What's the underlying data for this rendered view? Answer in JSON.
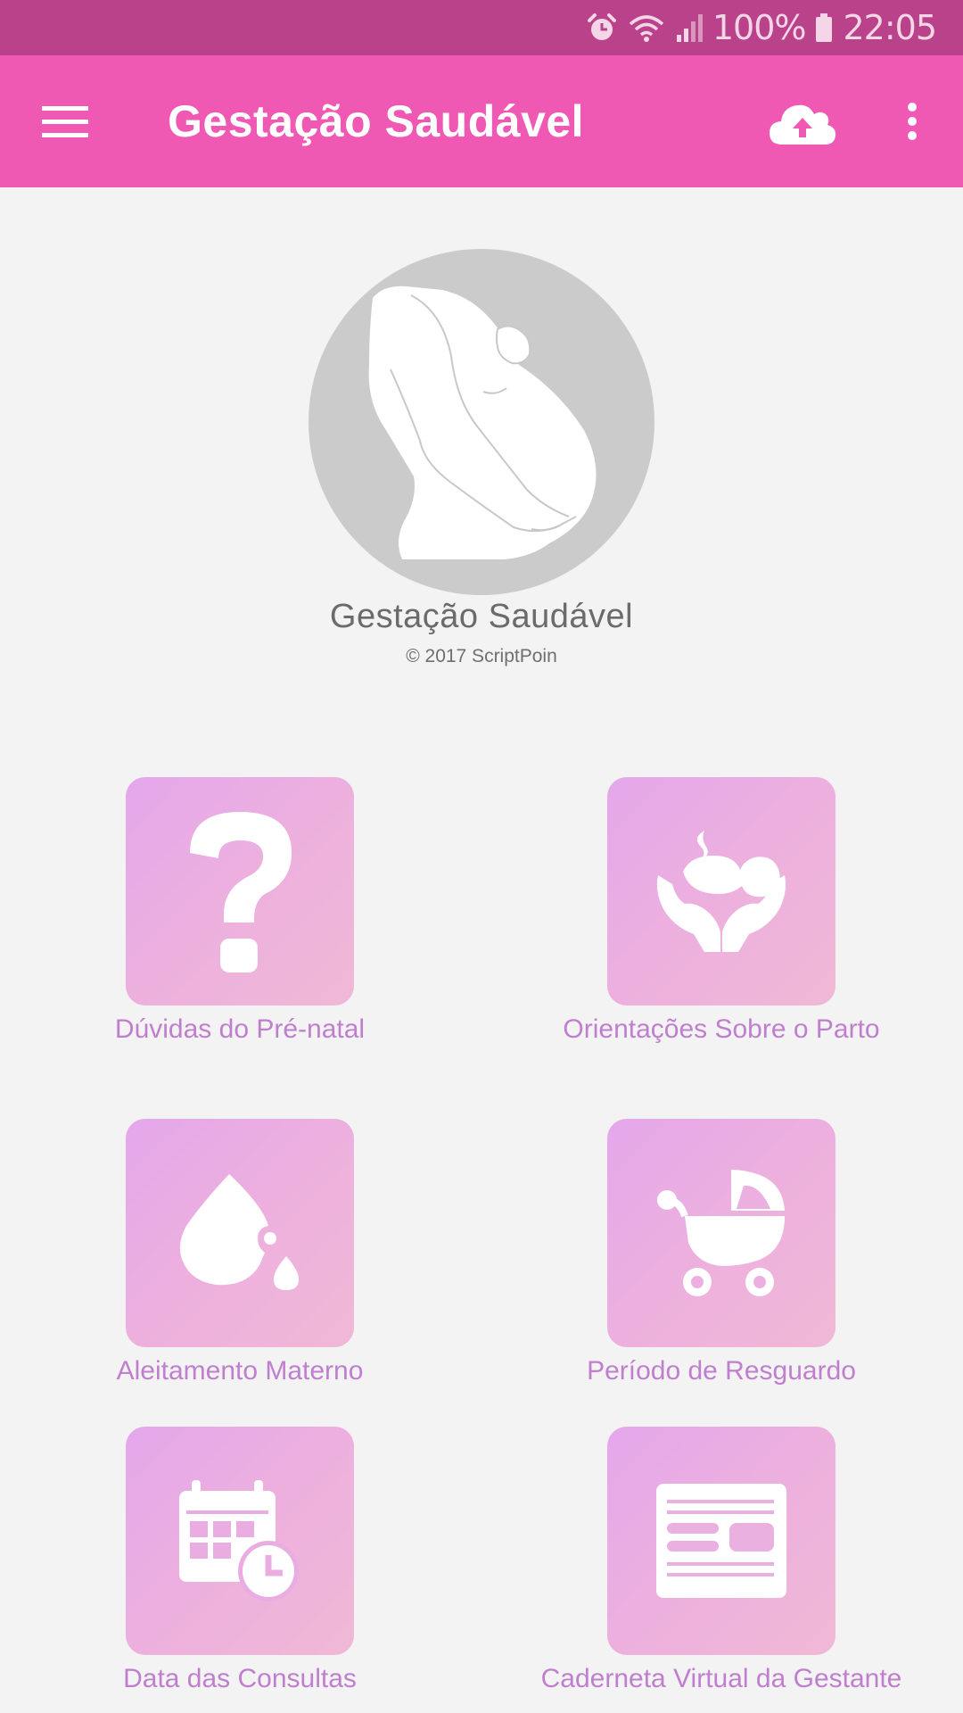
{
  "status_bar": {
    "battery": "100%",
    "time": "22:05",
    "icons": [
      "alarm-icon",
      "wifi-icon",
      "signal-icon",
      "battery-icon"
    ]
  },
  "app_bar": {
    "title": "Gestação Saudável",
    "icons": [
      "menu-icon",
      "cloud-upload-icon",
      "more-vert-icon"
    ],
    "color": "#ef58b3"
  },
  "hero": {
    "title": "Gestação Saudável",
    "copyright": "© 2017 ScriptPoin"
  },
  "tiles": [
    {
      "label": "Dúvidas do Pré-natal",
      "icon": "question-icon"
    },
    {
      "label": "Orientações Sobre o Parto",
      "icon": "baby-hands-icon"
    },
    {
      "label": "Aleitamento Materno",
      "icon": "milk-drop-icon"
    },
    {
      "label": "Período de Resguardo",
      "icon": "baby-stroller-icon"
    },
    {
      "label": "Data das Consultas",
      "icon": "calendar-clock-icon"
    },
    {
      "label": "Caderneta Virtual da Gestante",
      "icon": "document-icon"
    }
  ],
  "colors": {
    "status_bar": "#b9428a",
    "tile_text": "#c07fce",
    "background": "#f3f3f3"
  }
}
